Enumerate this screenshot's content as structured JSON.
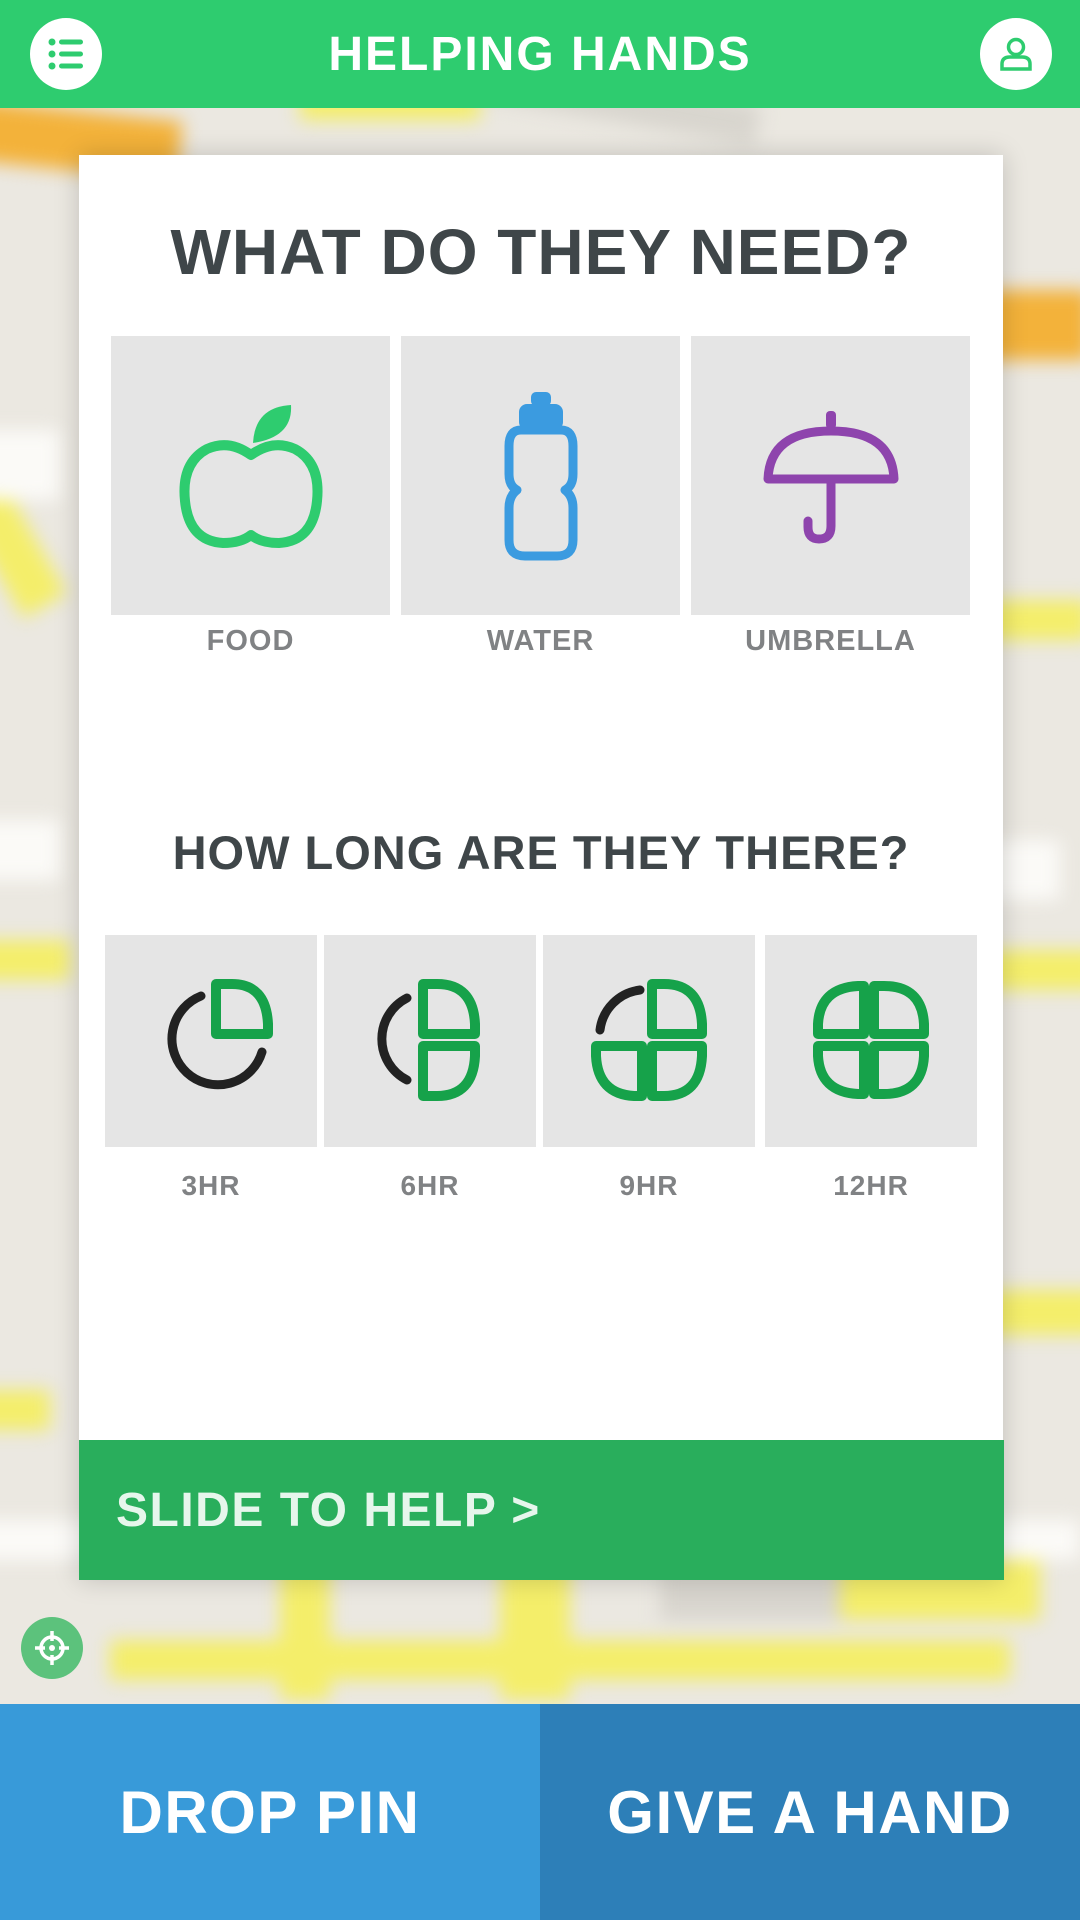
{
  "header": {
    "title": "HELPING HANDS",
    "menu_icon": "list-icon",
    "profile_icon": "user-icon",
    "color": "#2ecc6f"
  },
  "need_section": {
    "heading": "WHAT DO THEY NEED?",
    "items": [
      {
        "label": "FOOD",
        "icon": "apple-icon",
        "color": "#2ecc6f"
      },
      {
        "label": "WATER",
        "icon": "water-bottle-icon",
        "color": "#3b9be0"
      },
      {
        "label": "UMBRELLA",
        "icon": "umbrella-icon",
        "color": "#8e44ad"
      }
    ]
  },
  "duration_section": {
    "heading": "HOW LONG ARE THEY THERE?",
    "items": [
      {
        "label": "3HR",
        "icon": "quarter-clock-icon"
      },
      {
        "label": "6HR",
        "icon": "half-clock-icon"
      },
      {
        "label": "9HR",
        "icon": "three-quarter-clock-icon"
      },
      {
        "label": "12HR",
        "icon": "full-clock-icon"
      }
    ]
  },
  "slider": {
    "label": "SLIDE TO HELP >",
    "color": "#29ae5c"
  },
  "locate_icon": "crosshair-icon",
  "bottom_bar": {
    "drop_pin": "DROP PIN",
    "give_hand": "GIVE A HAND",
    "drop_color": "#389ad9",
    "give_color": "#2d7fb8"
  }
}
